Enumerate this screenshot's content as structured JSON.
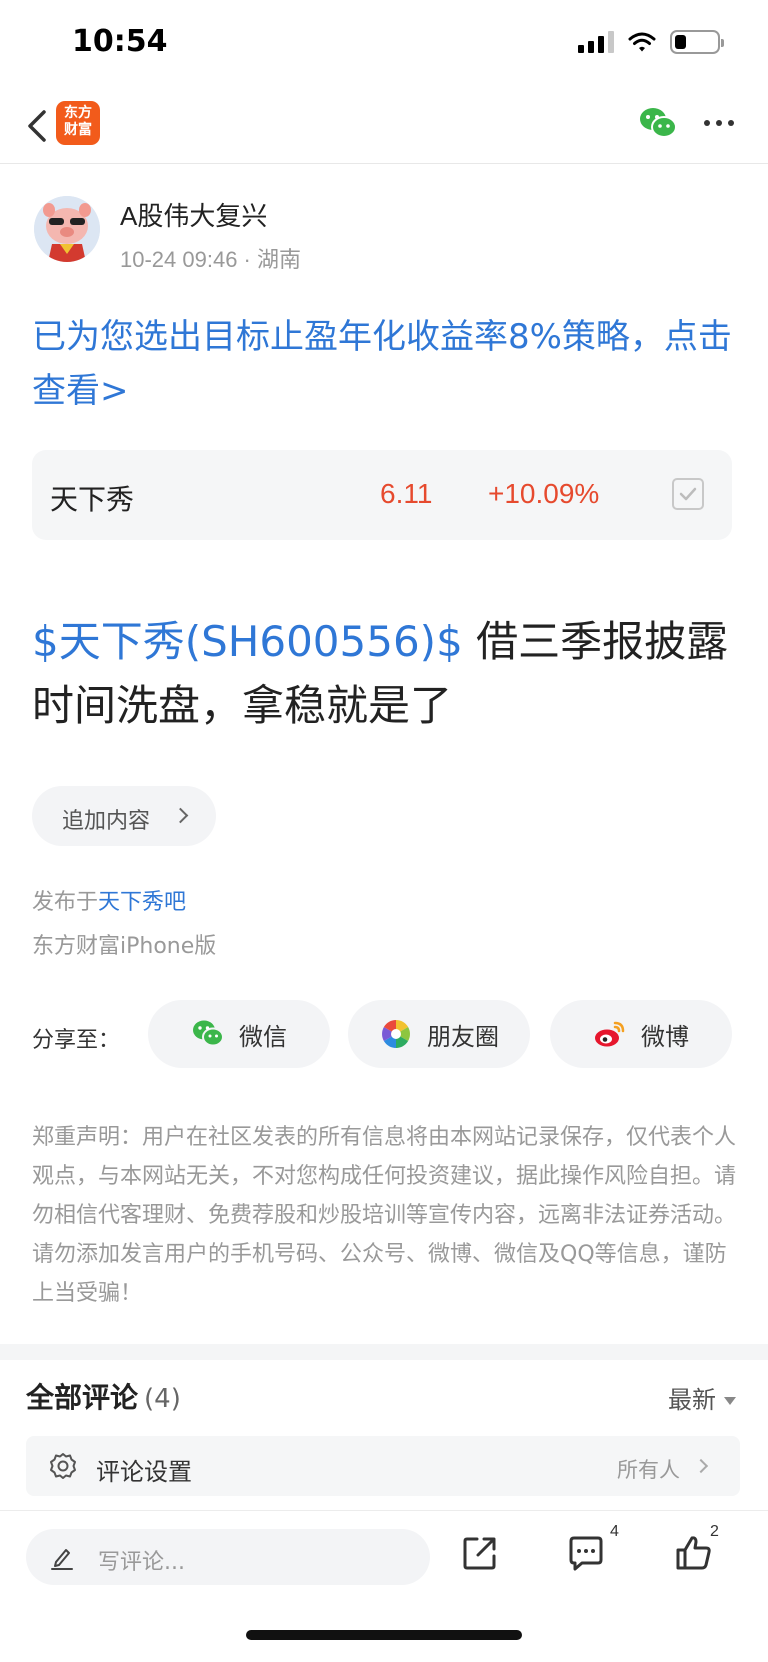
{
  "status_bar": {
    "time": "10:54"
  },
  "nav": {
    "logo_line1": "东方",
    "logo_line2": "财富"
  },
  "author": {
    "name": "A股伟大复兴",
    "meta": "10-24 09:46 · 湖南"
  },
  "promo": {
    "text": "已为您选出目标止盈年化收益率8%策略，点击查看>"
  },
  "stock": {
    "name": "天下秀",
    "price": "6.11",
    "change": "+10.09%"
  },
  "post": {
    "tag": "$天下秀(SH600556)$",
    "text": " 借三季报披露时间洗盘，拿稳就是了"
  },
  "add_content": {
    "label": "追加内容"
  },
  "publish": {
    "prefix": "发布于",
    "bar_name": "天下秀吧",
    "client": "东方财富iPhone版"
  },
  "share": {
    "label": "分享至：",
    "wechat": "微信",
    "moments": "朋友圈",
    "weibo": "微博"
  },
  "disclaimer": {
    "text": "郑重声明：用户在社区发表的所有信息将由本网站记录保存，仅代表个人观点，与本网站无关，不对您构成任何投资建议，据此操作风险自担。请勿相信代客理财、免费荐股和炒股培训等宣传内容，远离非法证券活动。请勿添加发言用户的手机号码、公众号、微博、微信及QQ等信息，谨防上当受骗！"
  },
  "comments": {
    "title": "全部评论",
    "count": "(4)",
    "sort": "最新",
    "settings_label": "评论设置",
    "settings_value": "所有人"
  },
  "bottom": {
    "placeholder": "写评论...",
    "comment_count": "4",
    "like_count": "2"
  },
  "colors": {
    "accent_blue": "#2f77d6",
    "stock_red": "#e64a2e",
    "brand_orange": "#f25b1b"
  },
  "icons": [
    "back-icon",
    "wechat-icon",
    "more-icon",
    "moments-icon",
    "weibo-icon",
    "settings-icon",
    "pencil-icon",
    "share-icon",
    "comment-icon",
    "like-icon"
  ]
}
